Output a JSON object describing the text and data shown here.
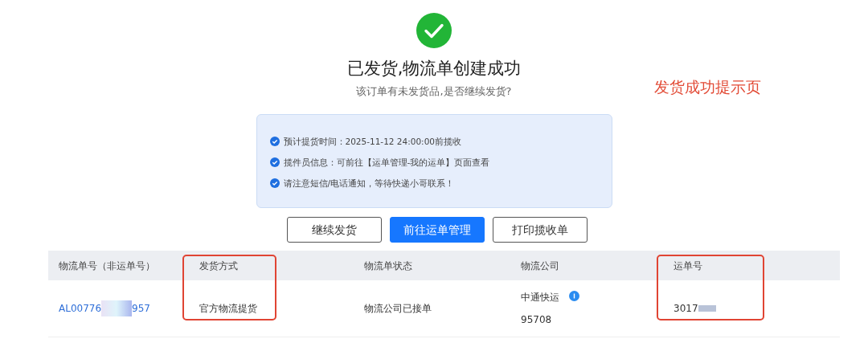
{
  "result": {
    "kind": "success",
    "title": "已发货,物流单创建成功",
    "subtitle": "该订单有未发货品,是否继续发货?"
  },
  "annotation": {
    "label": "发货成功提示页"
  },
  "notices": [
    "预计提货时间：2025-11-12 24:00:00前揽收",
    "揽件员信息：可前往【运单管理-我的运单】页面查看",
    "请注意短信/电话通知，等待快递小哥联系！"
  ],
  "buttons": [
    {
      "label": "继续发货",
      "primary": false
    },
    {
      "label": "前往运单管理",
      "primary": true
    },
    {
      "label": "打印揽收单",
      "primary": false
    }
  ],
  "table": {
    "columns": [
      {
        "label": "物流单号（非运单号）",
        "highlighted": false
      },
      {
        "label": "发货方式",
        "highlighted": true
      },
      {
        "label": "物流单状态",
        "highlighted": false
      },
      {
        "label": "物流公司",
        "highlighted": false
      },
      {
        "label": "运单号",
        "highlighted": true
      }
    ],
    "rows": [
      {
        "logistics_number_start": "AL00776",
        "logistics_number_end": "957",
        "shipping_method": "官方物流提货",
        "status": "物流公司已接单",
        "company": "中通快运",
        "company_line_2": "95708",
        "waybill_number": "3017"
      }
    ]
  }
}
